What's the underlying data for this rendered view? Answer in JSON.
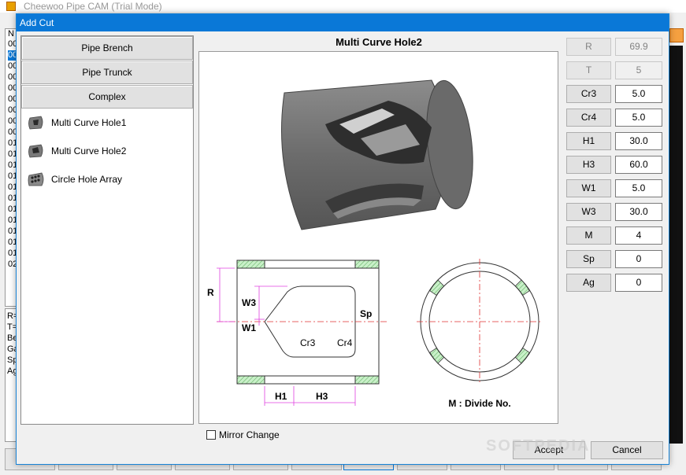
{
  "background": {
    "title": "Cheewoo Pipe CAM (Trial Mode)",
    "list_header": "N",
    "list_rows": [
      "00",
      "00",
      "00",
      "00",
      "00",
      "00",
      "00",
      "00",
      "00",
      "01",
      "01",
      "01",
      "01",
      "01",
      "01",
      "01",
      "01",
      "01",
      "01",
      "01",
      "02"
    ],
    "info_rows": [
      "R=",
      "T=",
      "Be",
      "Ga",
      "Sp",
      "Ag"
    ]
  },
  "dialog": {
    "title": "Add Cut"
  },
  "categories": [
    {
      "label": "Pipe Brench"
    },
    {
      "label": "Pipe Trunck"
    },
    {
      "label": "Complex"
    }
  ],
  "items": [
    {
      "label": "Multi Curve Hole1",
      "icon": "pipe-hole-icon"
    },
    {
      "label": "Multi Curve Hole2",
      "icon": "pipe-hole-icon"
    },
    {
      "label": "Circle Hole Array",
      "icon": "pipe-array-icon"
    }
  ],
  "diagram": {
    "title": "Multi Curve Hole2",
    "labels": {
      "R": "R",
      "W3": "W3",
      "W1": "W1",
      "Sp": "Sp",
      "Cr3": "Cr3",
      "Cr4": "Cr4",
      "H1": "H1",
      "H3": "H3",
      "divide": "M : Divide No."
    }
  },
  "params": [
    {
      "label": "R",
      "value": "69.9",
      "disabled": true
    },
    {
      "label": "T",
      "value": "5",
      "disabled": true
    },
    {
      "label": "Cr3",
      "value": "5.0",
      "disabled": false
    },
    {
      "label": "Cr4",
      "value": "5.0",
      "disabled": false
    },
    {
      "label": "H1",
      "value": "30.0",
      "disabled": false
    },
    {
      "label": "H3",
      "value": "60.0",
      "disabled": false
    },
    {
      "label": "W1",
      "value": "5.0",
      "disabled": false
    },
    {
      "label": "W3",
      "value": "30.0",
      "disabled": false
    },
    {
      "label": "M",
      "value": "4",
      "disabled": false
    },
    {
      "label": "Sp",
      "value": "0",
      "disabled": false
    },
    {
      "label": "Ag",
      "value": "0",
      "disabled": false
    }
  ],
  "footer": {
    "mirror_label": "Mirror Change",
    "mirror_checked": false,
    "accept_label": "Accept",
    "cancel_label": "Cancel"
  },
  "watermark": "SOFTPEDIA",
  "colors": {
    "accent": "#0a78d7",
    "hatch": "#8fd88f",
    "dimension": "#e040e0",
    "centerline": "#e03030"
  }
}
